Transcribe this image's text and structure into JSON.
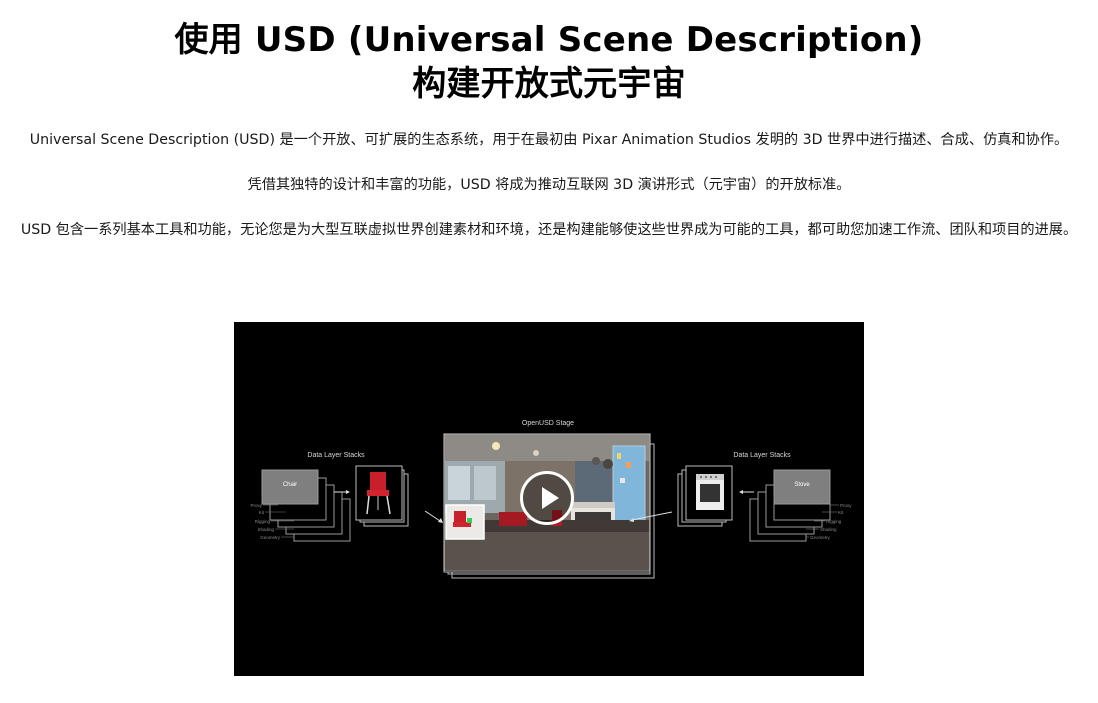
{
  "header": {
    "title_line1": "使用 USD (Universal Scene Description)",
    "title_line2": "构建开放式元宇宙"
  },
  "paragraphs": {
    "p1": "Universal Scene Description (USD) 是一个开放、可扩展的生态系统，用于在最初由 Pixar Animation Studios 发明的 3D 世界中进行描述、合成、仿真和协作。",
    "p2": "凭借其独特的设计和丰富的功能，USD 将成为推动互联网 3D 演讲形式（元宇宙）的开放标准。",
    "p3": "USD 包含一系列基本工具和功能，无论您是为大型互联虚拟世界创建素材和环境，还是构建能够使这些世界成为可能的工具，都可助您加速工作流、团队和项目的进展。"
  },
  "video": {
    "stage_label": "OpenUSD Stage",
    "left_stack_title": "Data Layer Stacks",
    "right_stack_title": "Data Layer Stacks",
    "left_asset_label": "Chair",
    "right_asset_label": "Stove",
    "left_layer_labels": [
      "Proxy",
      "Kit",
      "Rigging",
      "Shading",
      "Geometry"
    ],
    "right_layer_labels": [
      "Proxy",
      "Kit",
      "Rigging",
      "Shading",
      "Geometry"
    ],
    "play_icon": "play-icon"
  }
}
